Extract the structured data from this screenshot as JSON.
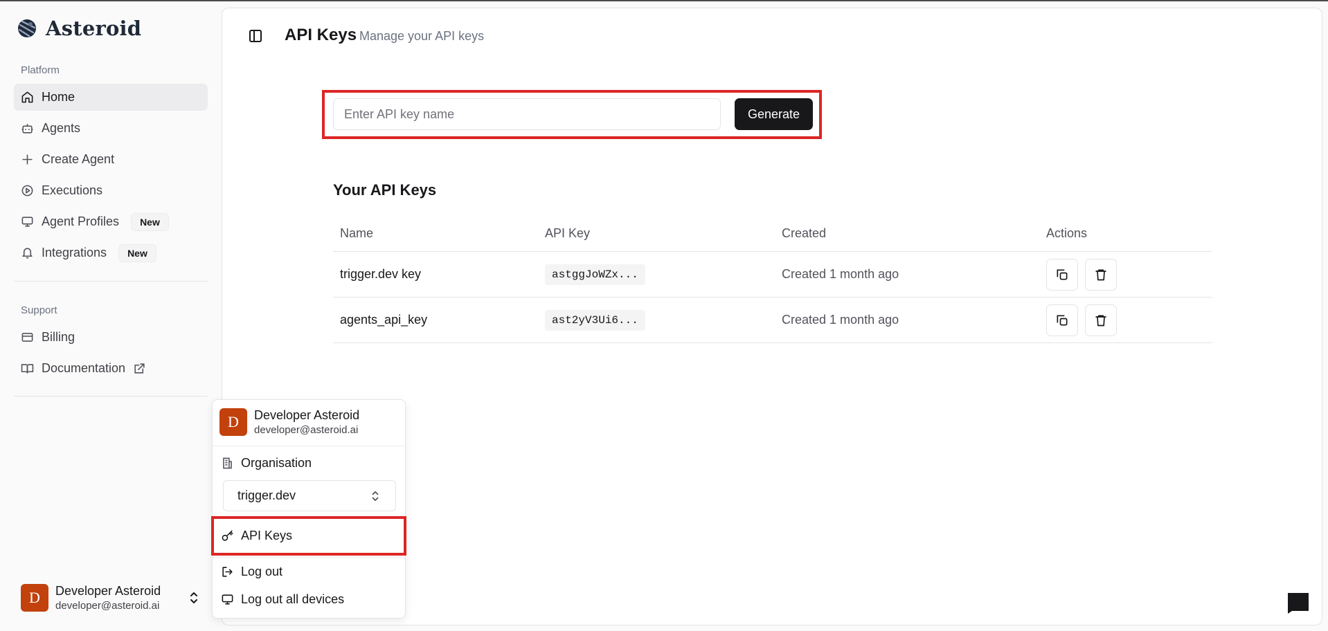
{
  "brand": {
    "name": "Asteroid"
  },
  "sidebar": {
    "platform_label": "Platform",
    "items": [
      {
        "label": "Home",
        "icon": "home-icon",
        "active": true
      },
      {
        "label": "Agents",
        "icon": "bot-icon"
      },
      {
        "label": "Create Agent",
        "icon": "plus-icon"
      },
      {
        "label": "Executions",
        "icon": "play-circle-icon"
      },
      {
        "label": "Agent Profiles",
        "icon": "monitor-icon",
        "badge": "New"
      },
      {
        "label": "Integrations",
        "icon": "bell-icon",
        "badge": "New"
      }
    ],
    "support_label": "Support",
    "support_items": [
      {
        "label": "Billing",
        "icon": "credit-card-icon"
      },
      {
        "label": "Documentation",
        "icon": "book-icon"
      }
    ],
    "user": {
      "initial": "D",
      "name": "Developer Asteroid",
      "email": "developer@asteroid.ai"
    }
  },
  "header": {
    "title": "API Keys",
    "subtitle": "Manage your API keys"
  },
  "generator": {
    "placeholder": "Enter API key name",
    "button_label": "Generate"
  },
  "keys_section": {
    "heading": "Your API Keys",
    "columns": [
      "Name",
      "API Key",
      "Created",
      "Actions"
    ],
    "rows": [
      {
        "name": "trigger.dev key",
        "key": "astggJoWZx...",
        "created": "Created 1 month ago"
      },
      {
        "name": "agents_api_key",
        "key": "ast2yV3Ui6...",
        "created": "Created 1 month ago"
      }
    ]
  },
  "menu": {
    "user": {
      "initial": "D",
      "name": "Developer Asteroid",
      "email": "developer@asteroid.ai"
    },
    "organisation_label": "Organisation",
    "org_selected": "trigger.dev",
    "api_keys_label": "API Keys",
    "logout_label": "Log out",
    "logout_all_label": "Log out all devices"
  },
  "colors": {
    "accent_dark": "#18181b",
    "avatar": "#c2410c",
    "highlight": "#dc2626"
  }
}
